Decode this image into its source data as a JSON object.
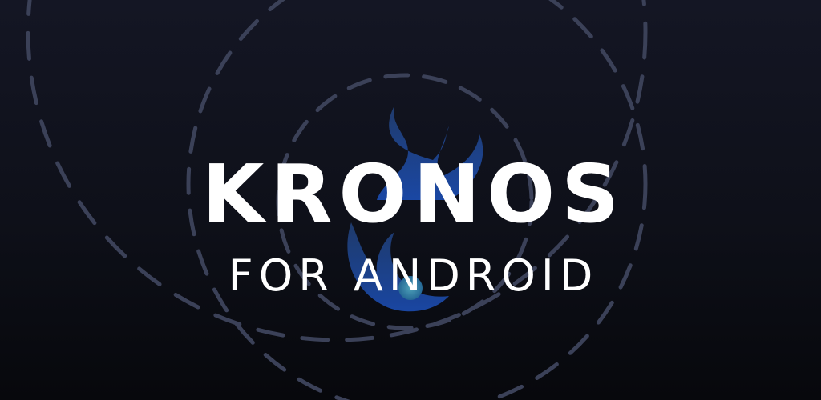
{
  "banner": {
    "title": "KRONOS",
    "subtitle": "FOR ANDROID"
  },
  "colors": {
    "background": "#0e1019",
    "ring": "#3b4158",
    "flame_top": "#2a4e9a",
    "flame_bottom": "#1e56c4",
    "dot": "#4db3d6",
    "text": "#ffffff"
  },
  "icons": {
    "logo": "kronos-flame-logo",
    "orbits": "dashed-orbit-rings"
  }
}
